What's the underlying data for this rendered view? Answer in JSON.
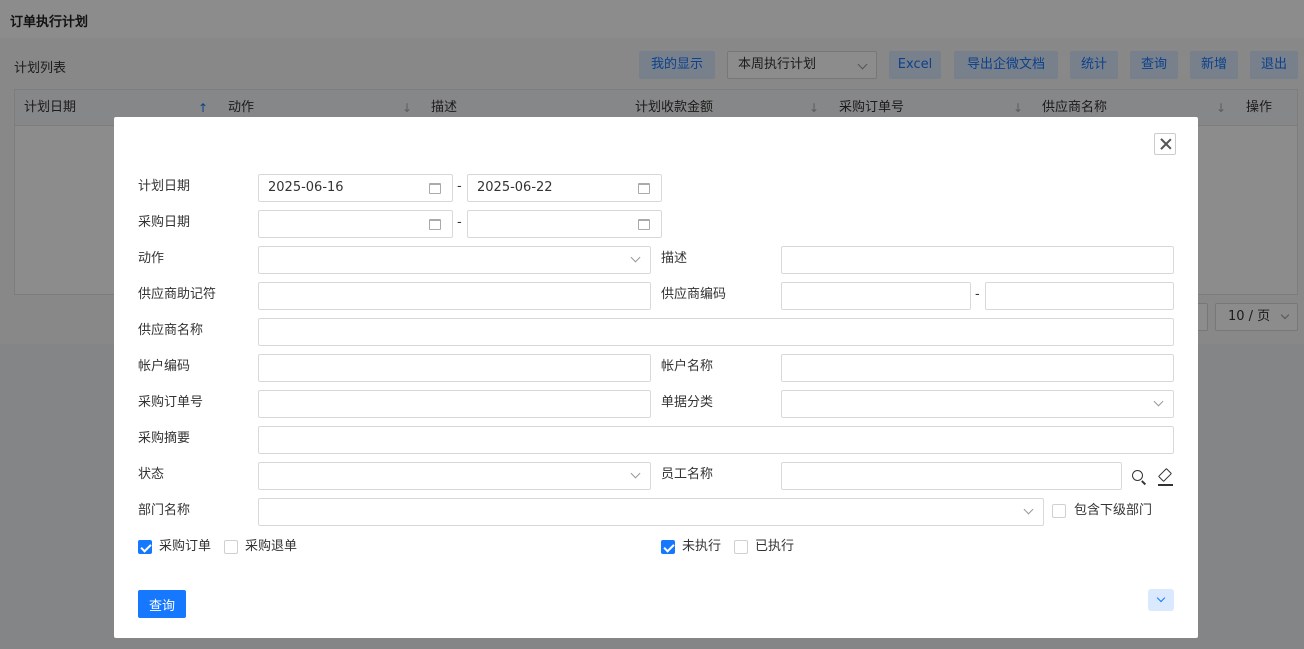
{
  "page": {
    "title": "订单执行计划"
  },
  "list": {
    "title": "计划列表"
  },
  "toolbar": {
    "my_display": "我的显示",
    "period_select": "本周执行计划",
    "excel": "Excel",
    "export_wecom": "导出企微文档",
    "stats": "统计",
    "query": "查询",
    "add": "新增",
    "exit": "退出"
  },
  "grid": {
    "columns": [
      "计划日期",
      "动作",
      "描述",
      "计划收款金额",
      "采购订单号",
      "供应商名称",
      "操作"
    ]
  },
  "pager": {
    "page_size": "10 / 页"
  },
  "filter": {
    "plan_date": {
      "label": "计划日期",
      "from": "2025-06-16",
      "to": "2025-06-22"
    },
    "purchase_date": {
      "label": "采购日期",
      "from": "",
      "to": ""
    },
    "action": {
      "label": "动作",
      "value": ""
    },
    "description": {
      "label": "描述",
      "value": ""
    },
    "supplier_mnemonic": {
      "label": "供应商助记符",
      "value": ""
    },
    "supplier_code": {
      "label": "供应商编码",
      "from": "",
      "to": ""
    },
    "supplier_name": {
      "label": "供应商名称",
      "value": ""
    },
    "account_code": {
      "label": "帐户编码",
      "value": ""
    },
    "account_name": {
      "label": "帐户名称",
      "value": ""
    },
    "po_number": {
      "label": "采购订单号",
      "value": ""
    },
    "doc_category": {
      "label": "单据分类",
      "value": ""
    },
    "purchase_summary": {
      "label": "采购摘要",
      "value": ""
    },
    "status": {
      "label": "状态",
      "value": ""
    },
    "employee_name": {
      "label": "员工名称",
      "value": ""
    },
    "dept_name": {
      "label": "部门名称",
      "value": ""
    },
    "include_sub_dept": {
      "label": "包含下级部门",
      "checked": false
    },
    "purchase_order": {
      "label": "采购订单",
      "checked": true
    },
    "purchase_return": {
      "label": "采购退单",
      "checked": false
    },
    "not_executed": {
      "label": "未执行",
      "checked": true
    },
    "executed": {
      "label": "已执行",
      "checked": false
    },
    "dash": "-",
    "query_button": "查询"
  }
}
